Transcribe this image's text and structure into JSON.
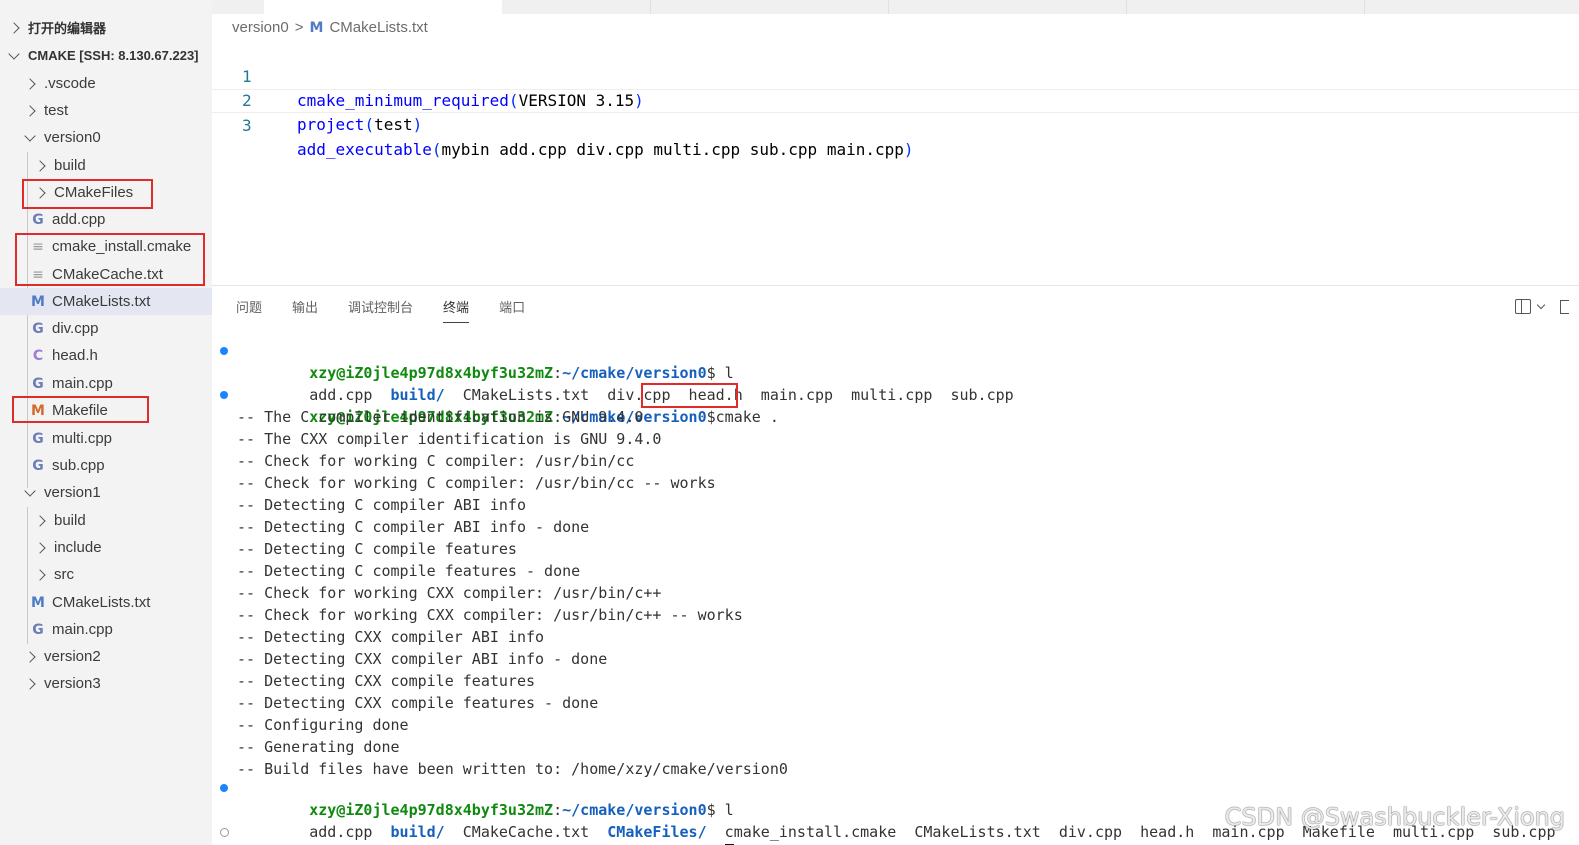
{
  "sidebar": {
    "open_editors_label": "打开的编辑器",
    "workspace_label": "CMAKE [SSH: 8.130.67.223]",
    "items": [
      {
        "label": ".vscode"
      },
      {
        "label": "test"
      },
      {
        "label": "version0"
      },
      {
        "label": "build"
      },
      {
        "label": "CMakeFiles"
      },
      {
        "label": "add.cpp"
      },
      {
        "label": "cmake_install.cmake"
      },
      {
        "label": "CMakeCache.txt"
      },
      {
        "label": "CMakeLists.txt"
      },
      {
        "label": "div.cpp"
      },
      {
        "label": "head.h"
      },
      {
        "label": "main.cpp"
      },
      {
        "label": "Makefile"
      },
      {
        "label": "multi.cpp"
      },
      {
        "label": "sub.cpp"
      },
      {
        "label": "version1"
      },
      {
        "label": "build"
      },
      {
        "label": "include"
      },
      {
        "label": "src"
      },
      {
        "label": "CMakeLists.txt"
      },
      {
        "label": "main.cpp"
      },
      {
        "label": "version2"
      },
      {
        "label": "version3"
      }
    ]
  },
  "editor": {
    "breadcrumb": {
      "folder": "version0",
      "separator": ">",
      "file_icon": "M",
      "file": "CMakeLists.txt"
    },
    "lines": [
      {
        "num": "1",
        "fn": "cmake_minimum_required",
        "open": "(",
        "args": "VERSION 3.15",
        "close": ")"
      },
      {
        "num": "2",
        "fn": "project",
        "open": "(",
        "args": "test",
        "close": ")"
      },
      {
        "num": "3",
        "fn": "add_executable",
        "open": "(",
        "args": "mybin add.cpp div.cpp multi.cpp sub.cpp main.cpp",
        "close": ")"
      }
    ]
  },
  "panel": {
    "tabs": [
      "问题",
      "输出",
      "调试控制台",
      "终端",
      "端口"
    ],
    "active_tab": "终端",
    "prompt_user": "xzy@iZ0jle4p97d8x4byf3u32mZ",
    "prompt_colon": ":",
    "prompt_path": "~/cmake/version0",
    "prompt_dollar": "$",
    "terminal": {
      "cmd1": " l",
      "ls1": {
        "a": "add.cpp  ",
        "dir": "build/",
        "b": "  CMakeLists.txt  div.cpp  head.h  main.cpp  multi.cpp  sub.cpp"
      },
      "cmd2": "cmake .",
      "output": [
        "-- The C compiler identification is GNU 9.4.0",
        "-- The CXX compiler identification is GNU 9.4.0",
        "-- Check for working C compiler: /usr/bin/cc",
        "-- Check for working C compiler: /usr/bin/cc -- works",
        "-- Detecting C compiler ABI info",
        "-- Detecting C compiler ABI info - done",
        "-- Detecting C compile features",
        "-- Detecting C compile features - done",
        "-- Check for working CXX compiler: /usr/bin/c++",
        "-- Check for working CXX compiler: /usr/bin/c++ -- works",
        "-- Detecting CXX compiler ABI info",
        "-- Detecting CXX compiler ABI info - done",
        "-- Detecting CXX compile features",
        "-- Detecting CXX compile features - done",
        "-- Configuring done",
        "-- Generating done",
        "-- Build files have been written to: /home/xzy/cmake/version0"
      ],
      "cmd3": " l",
      "ls2": {
        "a": "add.cpp  ",
        "dir1": "build/",
        "b": "  CMakeCache.txt  ",
        "dir2": "CMakeFiles/",
        "c": "  cmake_install.cmake  CMakeLists.txt  div.cpp  head.h  main.cpp  Makefile  multi.cpp  sub.cpp"
      }
    }
  },
  "watermark": "CSDN @Swashbuckler-Xiong",
  "colors": {
    "highlight_box": "#e02b2b",
    "prompt_user": "#0f8a0f",
    "prompt_path": "#1560bd",
    "keyword": "#0000ff"
  }
}
